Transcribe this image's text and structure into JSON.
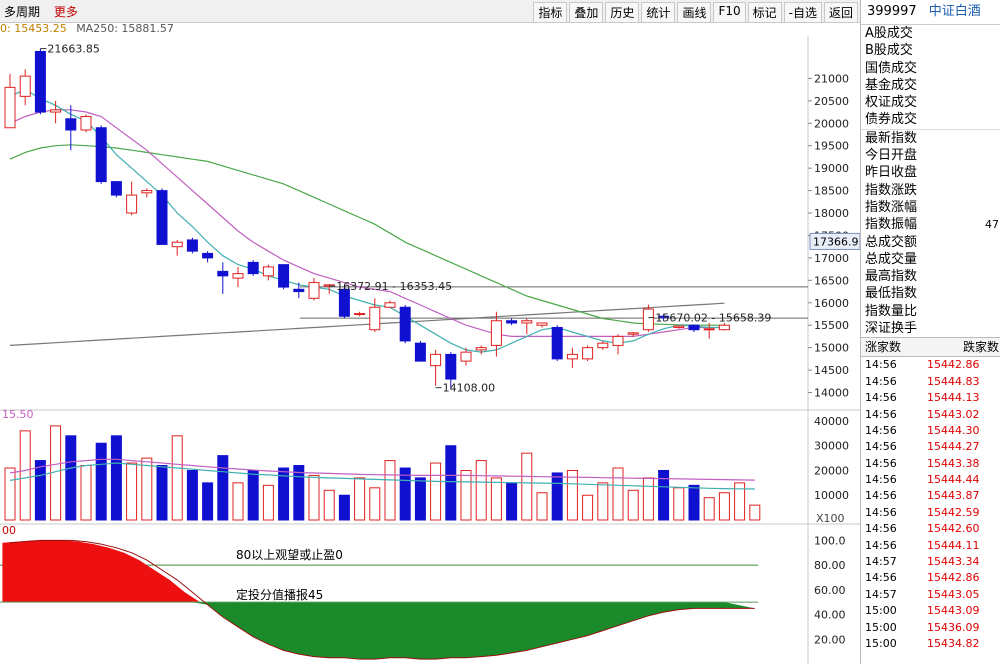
{
  "toolbar": {
    "left": [
      "多周期",
      "更多"
    ],
    "buttons": [
      "指标",
      "叠加",
      "历史",
      "统计",
      "画线",
      "F10",
      "标记",
      "-自选",
      "返回"
    ]
  },
  "ma_labels": {
    "ma1": "0: 15453.25",
    "ma2": "MA250: 15881.57"
  },
  "indicator_labels": {
    "vol": "15.50",
    "x100": "X100",
    "osc_start": "00",
    "upper_text": "80以上观望或止盈0",
    "mid_text": "定投分值播报45"
  },
  "price_panel": {
    "price_min": 13700,
    "price_max": 21900,
    "y_ticks": [
      14000,
      14500,
      15000,
      15500,
      16000,
      16500,
      17000,
      17500,
      18000,
      18500,
      19000,
      19500,
      20000,
      20500,
      21000
    ],
    "current_price_label": "17366.9",
    "current_price": 17366.9,
    "annotations": [
      {
        "text": "21663.85",
        "x_index": 2,
        "price": 21663.85,
        "side": "right"
      },
      {
        "text": "16372.91 - 16353.45",
        "x_index": 21,
        "price": 16372.91,
        "side": "right"
      },
      {
        "text": "14108.00",
        "x_index": 28,
        "price": 14108.0,
        "side": "right"
      },
      {
        "text": "15670.02 - 15658.39",
        "x_index": 42,
        "price": 15670.02,
        "side": "right"
      }
    ],
    "hlines": [
      16353.45,
      15658.39
    ]
  },
  "chart_data": {
    "type": "candlestick",
    "candles": [
      {
        "o": 19900,
        "h": 21100,
        "l": 19900,
        "c": 20800
      },
      {
        "o": 20600,
        "h": 21200,
        "l": 20400,
        "c": 21050
      },
      {
        "o": 21600,
        "h": 21663.85,
        "l": 20200,
        "c": 20250
      },
      {
        "o": 20250,
        "h": 20500,
        "l": 20000,
        "c": 20300
      },
      {
        "o": 20100,
        "h": 20400,
        "l": 19400,
        "c": 19850
      },
      {
        "o": 19850,
        "h": 20200,
        "l": 19800,
        "c": 20150
      },
      {
        "o": 19900,
        "h": 19950,
        "l": 18650,
        "c": 18700
      },
      {
        "o": 18700,
        "h": 18700,
        "l": 18350,
        "c": 18400
      },
      {
        "o": 18000,
        "h": 18700,
        "l": 17950,
        "c": 18400
      },
      {
        "o": 18450,
        "h": 18550,
        "l": 18350,
        "c": 18500
      },
      {
        "o": 18500,
        "h": 18550,
        "l": 17300,
        "c": 17300
      },
      {
        "o": 17250,
        "h": 17400,
        "l": 17050,
        "c": 17350
      },
      {
        "o": 17400,
        "h": 17450,
        "l": 17100,
        "c": 17150
      },
      {
        "o": 17100,
        "h": 17150,
        "l": 16900,
        "c": 17000
      },
      {
        "o": 16700,
        "h": 16900,
        "l": 16200,
        "c": 16600
      },
      {
        "o": 16550,
        "h": 16800,
        "l": 16350,
        "c": 16650
      },
      {
        "o": 16900,
        "h": 16950,
        "l": 16600,
        "c": 16650
      },
      {
        "o": 16600,
        "h": 16850,
        "l": 16500,
        "c": 16800
      },
      {
        "o": 16850,
        "h": 16850,
        "l": 16300,
        "c": 16350
      },
      {
        "o": 16300,
        "h": 16450,
        "l": 16100,
        "c": 16250
      },
      {
        "o": 16100,
        "h": 16550,
        "l": 16050,
        "c": 16450
      },
      {
        "o": 16372.91,
        "h": 16420,
        "l": 16200,
        "c": 16400
      },
      {
        "o": 16300,
        "h": 16350,
        "l": 15650,
        "c": 15700
      },
      {
        "o": 15750,
        "h": 15800,
        "l": 15700,
        "c": 15760
      },
      {
        "o": 15400,
        "h": 16100,
        "l": 15350,
        "c": 15900
      },
      {
        "o": 15900,
        "h": 16050,
        "l": 15900,
        "c": 16000
      },
      {
        "o": 15900,
        "h": 15950,
        "l": 15100,
        "c": 15150
      },
      {
        "o": 15100,
        "h": 15150,
        "l": 14700,
        "c": 14700
      },
      {
        "o": 14600,
        "h": 14950,
        "l": 14150,
        "c": 14850
      },
      {
        "o": 14850,
        "h": 14900,
        "l": 14108,
        "c": 14300
      },
      {
        "o": 14700,
        "h": 15000,
        "l": 14600,
        "c": 14900
      },
      {
        "o": 14950,
        "h": 15050,
        "l": 14850,
        "c": 15000
      },
      {
        "o": 15050,
        "h": 15800,
        "l": 14800,
        "c": 15600
      },
      {
        "o": 15600,
        "h": 15650,
        "l": 15500,
        "c": 15550
      },
      {
        "o": 15550,
        "h": 15650,
        "l": 15300,
        "c": 15600
      },
      {
        "o": 15500,
        "h": 15550,
        "l": 15450,
        "c": 15550
      },
      {
        "o": 15450,
        "h": 15500,
        "l": 14700,
        "c": 14750
      },
      {
        "o": 14750,
        "h": 15000,
        "l": 14550,
        "c": 14850
      },
      {
        "o": 14750,
        "h": 15050,
        "l": 14700,
        "c": 15000
      },
      {
        "o": 15000,
        "h": 15150,
        "l": 14950,
        "c": 15100
      },
      {
        "o": 15050,
        "h": 15300,
        "l": 14850,
        "c": 15250
      },
      {
        "o": 15300,
        "h": 15350,
        "l": 15250,
        "c": 15330
      },
      {
        "o": 15400,
        "h": 15960,
        "l": 15350,
        "c": 15860
      },
      {
        "o": 15700,
        "h": 15750,
        "l": 15600,
        "c": 15680
      },
      {
        "o": 15450,
        "h": 15500,
        "l": 15420,
        "c": 15480
      },
      {
        "o": 15500,
        "h": 15520,
        "l": 15350,
        "c": 15400
      },
      {
        "o": 15400,
        "h": 15550,
        "l": 15200,
        "c": 15420
      },
      {
        "o": 15400,
        "h": 15550,
        "l": 15380,
        "c": 15500
      }
    ],
    "ma5": [
      20600,
      20750,
      20550,
      20400,
      20200,
      20050,
      19700,
      19300,
      19000,
      18700,
      18400,
      18000,
      17700,
      17350,
      17050,
      16850,
      16750,
      16600,
      16500,
      16400,
      16350,
      16300,
      16150,
      16050,
      15950,
      15900,
      15700,
      15500,
      15300,
      15100,
      14950,
      14900,
      14950,
      15100,
      15250,
      15400,
      15450,
      15350,
      15250,
      15150,
      15100,
      15150,
      15300,
      15420,
      15500,
      15480,
      15450,
      15450
    ],
    "ma10": [
      20000,
      20150,
      20250,
      20300,
      20300,
      20250,
      20150,
      19900,
      19650,
      19400,
      19100,
      18800,
      18500,
      18200,
      17900,
      17600,
      17350,
      17150,
      16950,
      16800,
      16650,
      16550,
      16450,
      16350,
      16300,
      16250,
      16100,
      15950,
      15800,
      15650,
      15500,
      15400,
      15300,
      15250,
      15250,
      15250,
      15250,
      15250,
      15250,
      15250,
      15250,
      15250,
      15300,
      15350,
      15400,
      15450,
      15450,
      15450
    ],
    "ma60": [
      19200,
      19350,
      19450,
      19500,
      19520,
      19500,
      19480,
      19450,
      19400,
      19350,
      19300,
      19250,
      19200,
      19150,
      19050,
      18950,
      18850,
      18750,
      18650,
      18500,
      18350,
      18200,
      18050,
      17900,
      17750,
      17550,
      17350,
      17200,
      17050,
      16900,
      16750,
      16600,
      16450,
      16300,
      16150,
      16050,
      15950,
      15850,
      15750,
      15650,
      15600,
      15550,
      15530,
      15520,
      15510,
      15500,
      15500,
      15500
    ],
    "ma250": [
      15050,
      15070,
      15090,
      15110,
      15130,
      15150,
      15170,
      15190,
      15210,
      15230,
      15250,
      15270,
      15290,
      15310,
      15330,
      15350,
      15370,
      15390,
      15410,
      15430,
      15450,
      15470,
      15490,
      15510,
      15530,
      15550,
      15570,
      15590,
      15610,
      15630,
      15650,
      15670,
      15690,
      15710,
      15730,
      15750,
      15770,
      15790,
      15810,
      15830,
      15850,
      15870,
      15890,
      15910,
      15930,
      15950,
      15970,
      15990
    ],
    "volume": [
      21000,
      36000,
      24000,
      38000,
      34000,
      22000,
      31000,
      34000,
      23000,
      25000,
      22000,
      34000,
      20000,
      15000,
      26000,
      15000,
      20000,
      14000,
      21000,
      22000,
      18000,
      12000,
      10000,
      17000,
      13000,
      24000,
      21000,
      17000,
      23000,
      30000,
      20000,
      24000,
      17000,
      15000,
      27000,
      11000,
      19000,
      20000,
      10000,
      15000,
      21000,
      12000,
      17000,
      20000,
      13000,
      14000,
      9000,
      11000,
      15000,
      6000
    ],
    "vol_ma": [
      19000,
      20000,
      21500,
      22500,
      23500,
      24000,
      24500,
      24500,
      24000,
      23500,
      23000,
      22500,
      22000,
      21500,
      21000,
      20600,
      20200,
      19800,
      19500,
      19200,
      19000,
      18800,
      18600,
      18400,
      18300,
      18200,
      18100,
      18000,
      18000,
      18000,
      18000,
      17900,
      17800,
      17700,
      17600,
      17500,
      17400,
      17300,
      17200,
      17100,
      17000,
      16900,
      16800,
      16700,
      16600,
      16500,
      16400,
      16300,
      16200,
      16100
    ],
    "vol_ma2": [
      16000,
      17000,
      18000,
      19500,
      21000,
      22000,
      22500,
      23000,
      22500,
      22000,
      21500,
      21000,
      20500,
      20000,
      19500,
      19000,
      18500,
      18200,
      17800,
      17500,
      17200,
      17000,
      16800,
      16600,
      16400,
      16200,
      16000,
      15800,
      15600,
      15500,
      15400,
      15300,
      15200,
      15100,
      15000,
      14900,
      14800,
      14600,
      14400,
      14200,
      14000,
      13800,
      13600,
      13400,
      13200,
      13000,
      12800,
      12700,
      12600,
      12500
    ],
    "vol_ticks": [
      10000,
      20000,
      30000,
      40000
    ],
    "vol_max": 42000,
    "osc": [
      98,
      99,
      100,
      100,
      100,
      99,
      97,
      94,
      90,
      84,
      76,
      68,
      58,
      48,
      38,
      30,
      22,
      16,
      11,
      8,
      6,
      5,
      5,
      4,
      4,
      5,
      5,
      4,
      4,
      5,
      5,
      6,
      7,
      9,
      11,
      14,
      17,
      20,
      23,
      27,
      31,
      35,
      39,
      42,
      44,
      45,
      45,
      45,
      45,
      45
    ],
    "osc_ticks": [
      20,
      40,
      60,
      80,
      100
    ],
    "osc_tick_labels": [
      "20.00",
      "40.00",
      "60.00",
      "80.00",
      "100.0"
    ],
    "osc_midline": 50,
    "osc_upper": 80
  },
  "right_panel": {
    "code": "399997",
    "name": "中证白酒",
    "volume_labels": [
      "A股成交",
      "B股成交",
      "国债成交",
      "基金成交",
      "权证成交",
      "债券成交"
    ],
    "stats_labels": [
      "最新指数",
      "今日开盘",
      "昨日收盘",
      "指数涨跌",
      "指数涨幅",
      "指数振幅",
      "总成交额",
      "总成交量",
      "最高指数",
      "最低指数",
      "指数量比",
      "深证换手"
    ],
    "stats_partial_value": "47",
    "tick_header": [
      "涨家数",
      "跌家数"
    ],
    "ticks": [
      {
        "time": "14:56",
        "price": "15442.86"
      },
      {
        "time": "14:56",
        "price": "15444.83"
      },
      {
        "time": "14:56",
        "price": "15444.13"
      },
      {
        "time": "14:56",
        "price": "15443.02"
      },
      {
        "time": "14:56",
        "price": "15444.30"
      },
      {
        "time": "14:56",
        "price": "15444.27"
      },
      {
        "time": "14:56",
        "price": "15443.38"
      },
      {
        "time": "14:56",
        "price": "15444.44"
      },
      {
        "time": "14:56",
        "price": "15443.87"
      },
      {
        "time": "14:56",
        "price": "15442.59"
      },
      {
        "time": "14:56",
        "price": "15442.60"
      },
      {
        "time": "14:56",
        "price": "15444.11"
      },
      {
        "time": "14:57",
        "price": "15443.34"
      },
      {
        "time": "14:56",
        "price": "15442.86"
      },
      {
        "time": "14:57",
        "price": "15443.05"
      },
      {
        "time": "15:00",
        "price": "15443.09"
      },
      {
        "time": "15:00",
        "price": "15436.09"
      },
      {
        "time": "15:00",
        "price": "15434.82"
      }
    ]
  }
}
